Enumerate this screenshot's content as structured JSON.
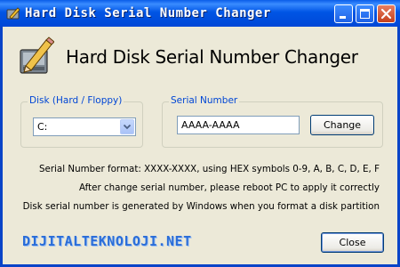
{
  "window": {
    "title": "Hard Disk Serial Number Changer",
    "title_bar_color": "#0055E5",
    "controls": [
      "minimize-icon",
      "maximize-icon",
      "close-icon"
    ]
  },
  "header": {
    "title": "Hard Disk Serial Number Changer",
    "icon": "pencil-disk-icon"
  },
  "disk": {
    "label": "Disk (Hard / Floppy)",
    "selected": "C:"
  },
  "serial": {
    "label": "Serial Number",
    "value": "AAAA-AAAA",
    "change_label": "Change"
  },
  "info": {
    "line1": "Serial Number format: XXXX-XXXX, using HEX symbols 0-9, A, B, C, D, E, F",
    "line2": "After change serial number, please reboot PC to apply it correctly",
    "line3": "Disk serial number is generated by Windows when you format a disk partition"
  },
  "watermark": "DIJITALTEKNOLOJI.NET",
  "footer": {
    "close_label": "Close"
  },
  "colors": {
    "group_label": "#0046D5",
    "dialog_bg": "#ECE9D8"
  }
}
